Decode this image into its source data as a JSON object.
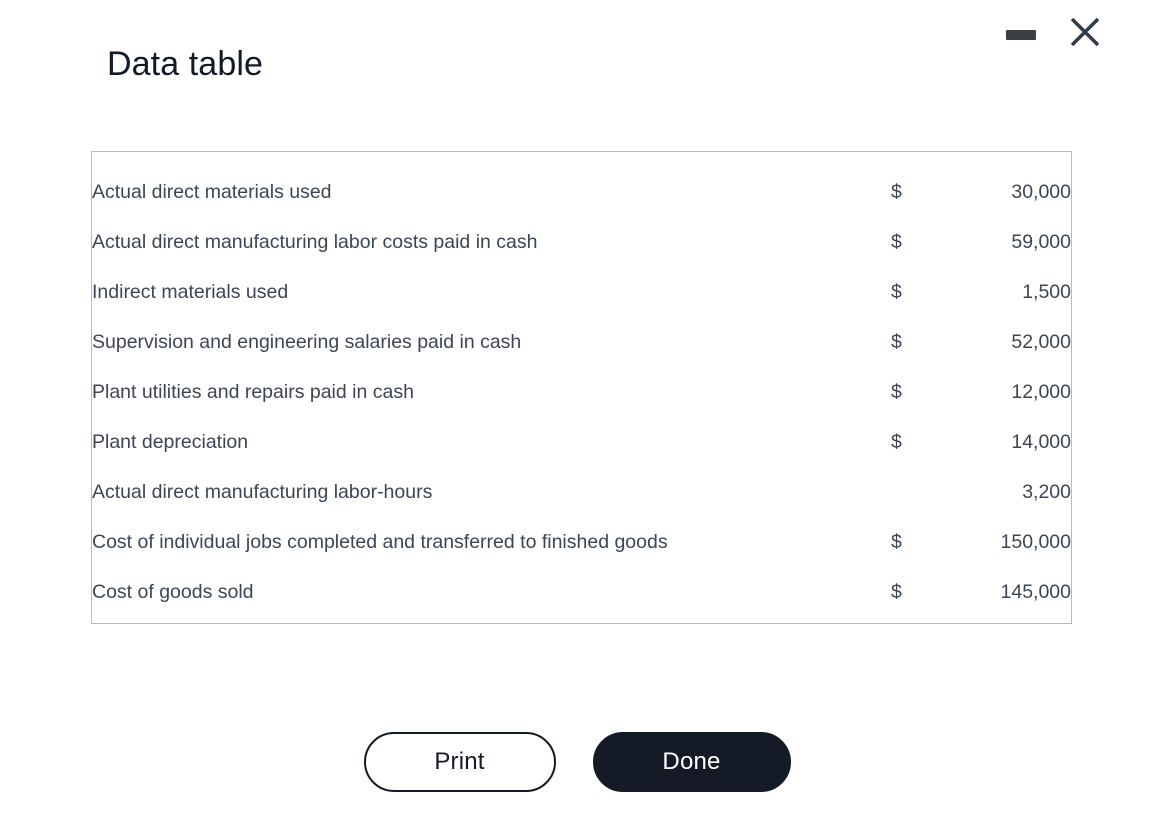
{
  "window": {
    "title": "Data table",
    "controls": {
      "minimize_label": "Minimize",
      "close_label": "Close"
    }
  },
  "table": {
    "rows": [
      {
        "label": "Actual direct materials used",
        "currency": "$",
        "value": "30,000"
      },
      {
        "label": "Actual direct manufacturing labor costs paid in cash",
        "currency": "$",
        "value": "59,000"
      },
      {
        "label": "Indirect materials used",
        "currency": "$",
        "value": "1,500"
      },
      {
        "label": "Supervision and engineering salaries paid in cash",
        "currency": "$",
        "value": "52,000"
      },
      {
        "label": "Plant utilities and repairs paid in cash",
        "currency": "$",
        "value": "12,000"
      },
      {
        "label": "Plant depreciation",
        "currency": "$",
        "value": "14,000"
      },
      {
        "label": "Actual direct manufacturing labor-hours",
        "currency": "",
        "value": "3,200"
      },
      {
        "label": "Cost of individual jobs completed and transferred to finished goods",
        "currency": "$",
        "value": "150,000"
      },
      {
        "label": "Cost of goods sold",
        "currency": "$",
        "value": "145,000"
      }
    ]
  },
  "footer": {
    "print_label": "Print",
    "done_label": "Done"
  },
  "colors": {
    "title_text": "#131a27",
    "table_text": "#3e4553",
    "table_border": "#b6b8bb",
    "primary_button_bg": "#151b26",
    "control_icon": "#333d4c"
  }
}
